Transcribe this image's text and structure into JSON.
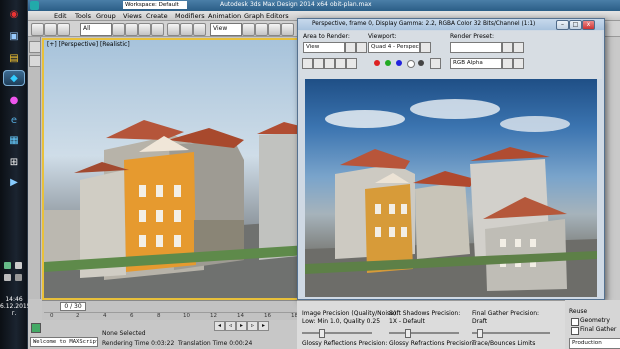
{
  "window": {
    "title": "Autodesk 3ds Max Design 2014 x64",
    "file": "obit-plan.max",
    "workspace": "Workspace: Default"
  },
  "menu": [
    "Edit",
    "Tools",
    "Group",
    "Views",
    "Create",
    "Modifiers",
    "Animation",
    "Graph Editors"
  ],
  "toolbar": {
    "selection_filter": "All",
    "view_dropdown": "View"
  },
  "viewport": {
    "label": "[+] [Perspective] [Realistic]"
  },
  "timeline": {
    "slider_text": "0 / 30",
    "ticks": [
      "0",
      "2",
      "4",
      "6",
      "8",
      "10",
      "12",
      "14",
      "16",
      "18"
    ]
  },
  "status": {
    "selection": "None Selected",
    "rendering_time": "Rendering Time 0:03:22",
    "translation_time": "Translation Time 0:00:24",
    "maxscript": "Welcome to MAXScript"
  },
  "taskbar": {
    "clock_time": "14:46",
    "clock_date": "6.12.2015 г."
  },
  "render_frame": {
    "title": "Perspective, frame 0, Display Gamma: 2.2, RGBA Color 32 Bits/Channel (1:1)",
    "area_label": "Area to Render:",
    "area_value": "View",
    "viewport_label": "Viewport:",
    "viewport_value": "Quad 4 - Perspec",
    "preset_label": "Render Preset:",
    "preset_value": "",
    "channel_value": "RGB Alpha"
  },
  "render_settings": {
    "image_precision_label": "Image Precision (Quality/Noise):",
    "image_precision_value": "Low: Min 1.0, Quality 0.25",
    "soft_shadows_label": "Soft Shadows Precision:",
    "soft_shadows_value": "1X - Default",
    "final_gather_label": "Final Gather Precision:",
    "final_gather_value": "Draft",
    "glossy_reflections_label": "Glossy Reflections Precision:",
    "glossy_refractions_label": "Glossy Refractions Precision:",
    "trace_bounces_label": "Trace/Bounces Limits",
    "reuse_label": "Reuse",
    "geometry_label": "Geometry",
    "final_gather_chk_label": "Final Gather",
    "production_value": "Production"
  },
  "colors": {
    "taskbar": "#141b24",
    "viewport_border": "#e8c03a",
    "titlebar": "#2b5e86"
  }
}
